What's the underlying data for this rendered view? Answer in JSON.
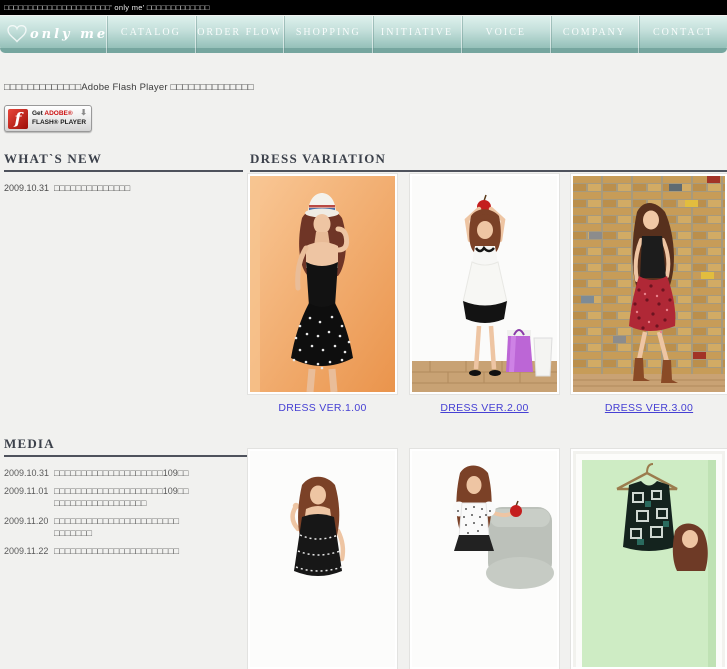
{
  "topbar": {
    "text": "□□□□□□□□□□□□□□□□□□□□□□' only me' □□□□□□□□□□□□□"
  },
  "nav": {
    "logo_text": "only me",
    "items": [
      {
        "label": "CATALOG"
      },
      {
        "label": "ORDER FLOW"
      },
      {
        "label": "SHOPPING"
      },
      {
        "label": "INITIATIVE"
      },
      {
        "label": "VOICE"
      },
      {
        "label": "COMPANY"
      },
      {
        "label": "CONTACT"
      }
    ],
    "colors": {
      "gradient_top": "#def1ed",
      "gradient_bottom": "#8ab8b1",
      "strip": "#76a69f"
    }
  },
  "flash": {
    "message": "□□□□□□□□□□□□□Adobe Flash Player □□□□□□□□□□□□□□",
    "button": {
      "get": "Get ",
      "brand": "ADOBE®",
      "line2": "FLASH® PLAYER"
    }
  },
  "icons": {
    "download_arrow": "⬇",
    "flash_f": "f"
  },
  "whats_new": {
    "title": "WHAT`S NEW",
    "items": [
      {
        "date": "2009.10.31",
        "text": "□□□□□□□□□□□□□□"
      }
    ]
  },
  "dress_variation": {
    "title": "DRESS VARIATION",
    "link_color": "#4640d4",
    "links": [
      {
        "label": "DRESS VER.1.00"
      },
      {
        "label": "DRESS VER.2.00"
      },
      {
        "label": "DRESS VER.3.00"
      }
    ],
    "photos": {
      "ver1_alt": "model in white fedora and black polka-dot dress on orange background",
      "ver2_alt": "model holding red apple overhead, white dress with black hem, purple bag and bin",
      "ver3_alt": "model leaning on multicolor brick wall, black top, red floral skirt, brown boots",
      "bottom1_alt": "model in black tiered dress on white background",
      "bottom2_alt": "model in polka-dot blouse with red apple beside grey sofa",
      "bottom3_alt": "black patterned dress on hanger against green backdrop, model at lower right"
    }
  },
  "media": {
    "title": "MEDIA",
    "items": [
      {
        "date": "2009.10.31",
        "line1": "□□□□□□□□□□□□□□□□□□□□109□□",
        "line2": ""
      },
      {
        "date": "2009.11.01",
        "line1": "□□□□□□□□□□□□□□□□□□□□109□□",
        "line2": "□□□□□□□□□□□□□□□□□"
      },
      {
        "date": "2009.11.20",
        "line1": "□□□□□□□□□□□□□□□□□□□□□□□",
        "line2": "□□□□□□□"
      },
      {
        "date": "2009.11.22",
        "line1": "□□□□□□□□□□□□□□□□□□□□□□□",
        "line2": ""
      }
    ]
  }
}
